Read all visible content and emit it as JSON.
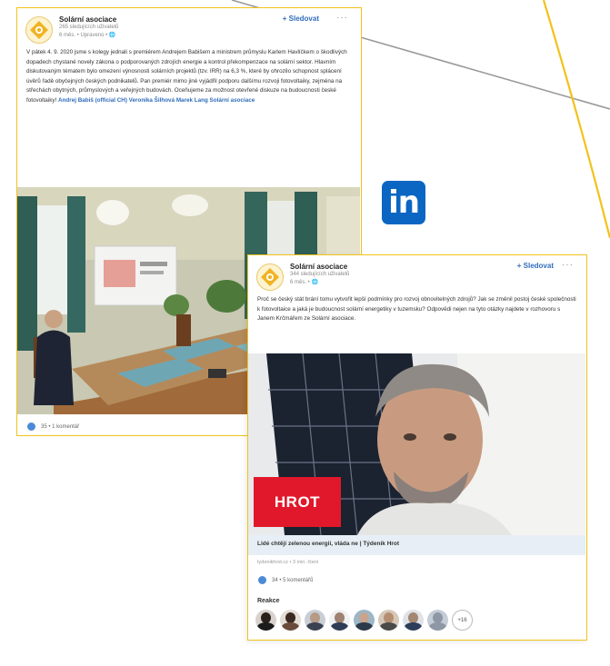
{
  "linkedin_logo": "in",
  "colors": {
    "accent_yellow": "#f2c21b",
    "link_blue": "#2f6dbb",
    "linkedin_blue": "#0a66c2",
    "hrot_red": "#e1182b"
  },
  "post1": {
    "org_name": "Solární asociace",
    "followers": "265 sledujících uživatelů",
    "meta": "6 měs. • Upraveno • 🌐",
    "follow_label": "+ Sledovat",
    "more_label": "···",
    "text": "V pátek 4. 9. 2020 jsme s kolegy jednali s premiérem Andrejem Babišem a ministrem průmyslu Karlem Havlíčkem o škodlivých dopadech chystané novely zákona o podporovaných zdrojích energie a kontrol překompenzace na solární sektor. Hlavním diskutovaným tématem bylo omezení výnosnosti solárních projektů (tzv. IRR) na 6,3 %, které by ohrozilo schopnost splácení úvěrů řadě obyčejných českých podnikatelů. Pan premiér mimo jiné vyjádřil podporu dalšímu rozvoji fotovoltaiky, zejména na střechách obytných, průmyslových a veřejných budovách. Oceňujeme za možnost otevřené diskuze na budoucnosti české fotovoltaiky!",
    "tags": "Andrej Babiš (official CH) Veronika Šilhová Marek Lang Solární asociace",
    "reactions": "35 • 1 komentář"
  },
  "post2": {
    "org_name": "Solární asociace",
    "followers": "344 sledujících uživatelů",
    "meta": "6 měs. • 🌐",
    "follow_label": "+ Sledovat",
    "more_label": "···",
    "text": "Proč se český stát brání tomu vytvořit lepší podmínky pro rozvoj obnovitelných zdrojů? Jak se změnil postoj české společnosti k fotovoltaice a jaká je budoucnost solární energetiky v tuzemsku? Odpovědi nejen na tyto otázky najdete v rozhovoru s Janem Krčmářem ze Solární asociace.",
    "badge": "HROT",
    "link_title": "Lidé chtějí zelenou energii, vláda ne | Týdeník Hrot",
    "link_source": "tydenikhrot.cz • 3 min. čtení",
    "reactions": "34 • 5 komentářů",
    "reactions_heading": "Reakce",
    "more_reactors": "+16"
  }
}
